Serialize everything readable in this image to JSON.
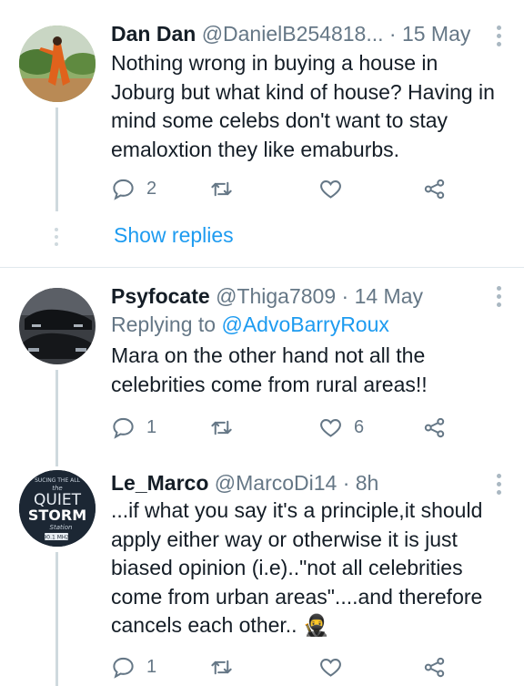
{
  "tweets": [
    {
      "name": "Dan Dan",
      "handle": "@DanielB254818...",
      "time": "· 15 May",
      "text": "Nothing wrong in buying a house in Joburg but what kind of house? Having in mind  some celebs don't want to stay emaloxtion they like emaburbs.",
      "reply_count": "2",
      "retweet_count": "",
      "like_count": "",
      "show_replies": "Show replies"
    },
    {
      "name": "Psyfocate",
      "handle": "@Thiga7809",
      "time": "· 14 May",
      "replying_prefix": "Replying to ",
      "replying_handle": "@AdvoBarryRoux",
      "text": "Mara on the other hand not all the celebrities come from rural areas!!",
      "reply_count": "1",
      "retweet_count": "",
      "like_count": "6"
    },
    {
      "name": "Le_Marco",
      "handle": "@MarcoDi14",
      "time": "· 8h",
      "text": "...if what you say it's a principle,it should apply either way or otherwise it is just biased opinion (i.e)..\"not all celebrities come from urban areas\"....and therefore cancels each other..",
      "emoji": "🥷",
      "reply_count": "1",
      "retweet_count": "",
      "like_count": "",
      "avatar_text": {
        "top": "SUCING THE ALL",
        "line1": "the",
        "line2": "QUIET",
        "line3": "STORM",
        "line4": "Station",
        "badge": "90.1 MHZ"
      }
    }
  ],
  "colors": {
    "accent": "#1d9bf0",
    "muted": "#657786",
    "text": "#141d26"
  }
}
